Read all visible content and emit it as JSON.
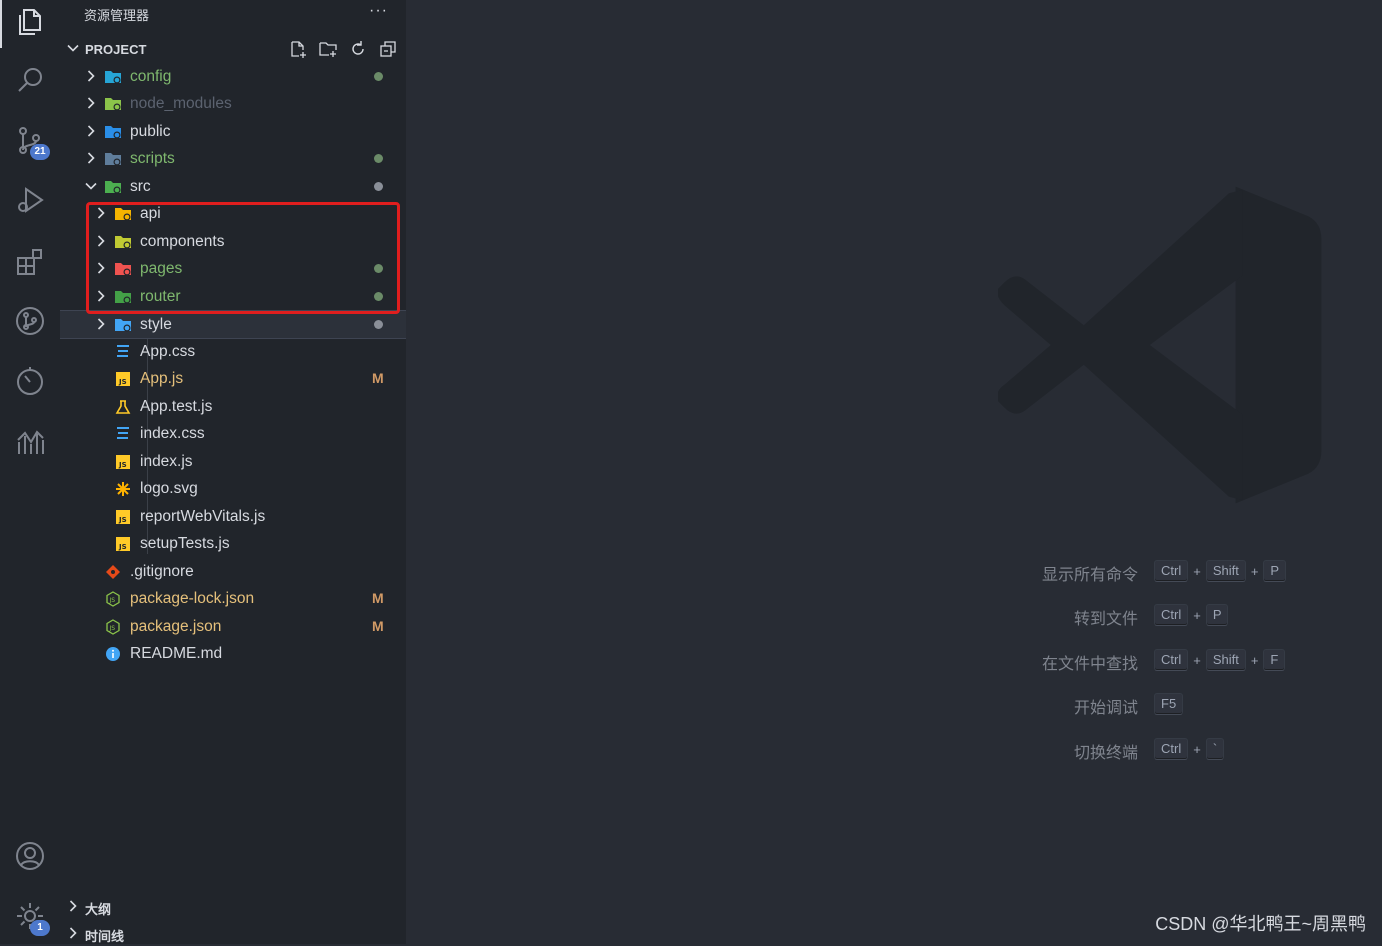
{
  "activity_bar": {
    "items": [
      {
        "name": "explorer-icon"
      },
      {
        "name": "search-icon"
      },
      {
        "name": "source-control-icon",
        "badge": "21"
      },
      {
        "name": "run-debug-icon"
      },
      {
        "name": "extensions-icon"
      },
      {
        "name": "git-graph-icon"
      },
      {
        "name": "timeline-icon"
      },
      {
        "name": "analytics-icon"
      }
    ],
    "bottom": [
      {
        "name": "account-icon"
      },
      {
        "name": "settings-gear-icon",
        "badge": "1"
      }
    ]
  },
  "sidebar": {
    "title": "资源管理器",
    "more_label": "···",
    "section": {
      "title": "PROJECT",
      "actions": [
        "new-file-icon",
        "new-folder-icon",
        "refresh-icon",
        "collapse-all-icon"
      ]
    },
    "tree": [
      {
        "label": "config",
        "type": "folder",
        "icon": "folder-config-icon",
        "icon_color": "#26a5d6",
        "text_color": "#7fb86e",
        "status": "dot",
        "dot_color": "#6b8b68",
        "depth": 0
      },
      {
        "label": "node_modules",
        "type": "folder",
        "icon": "folder-node-icon",
        "icon_color": "#8bc34a",
        "text_color": "#5c6370",
        "status": "",
        "depth": 0
      },
      {
        "label": "public",
        "type": "folder",
        "icon": "folder-public-icon",
        "icon_color": "#2a8ee8",
        "text_color": "#d7dae0",
        "status": "",
        "depth": 0
      },
      {
        "label": "scripts",
        "type": "folder",
        "icon": "folder-scripts-icon",
        "icon_color": "#5f7d9b",
        "text_color": "#7fb86e",
        "status": "dot",
        "dot_color": "#6b8b68",
        "depth": 0
      },
      {
        "label": "src",
        "type": "folder-open",
        "icon": "folder-src-icon",
        "icon_color": "#4caf50",
        "text_color": "#d7dae0",
        "status": "dot",
        "dot_color": "#8a8f98",
        "depth": 0
      },
      {
        "label": "api",
        "type": "folder",
        "icon": "folder-api-icon",
        "icon_color": "#f5b400",
        "text_color": "#d7dae0",
        "status": "",
        "depth": 1
      },
      {
        "label": "components",
        "type": "folder",
        "icon": "folder-components-icon",
        "icon_color": "#c0ca33",
        "text_color": "#d7dae0",
        "status": "",
        "depth": 1
      },
      {
        "label": "pages",
        "type": "folder",
        "icon": "folder-pages-icon",
        "icon_color": "#ef5350",
        "text_color": "#7fb86e",
        "status": "dot",
        "dot_color": "#6b8b68",
        "depth": 1
      },
      {
        "label": "router",
        "type": "folder",
        "icon": "folder-router-icon",
        "icon_color": "#43a047",
        "text_color": "#7fb86e",
        "status": "dot",
        "dot_color": "#6b8b68",
        "depth": 1
      },
      {
        "label": "style",
        "type": "folder",
        "icon": "folder-style-icon",
        "icon_color": "#42a5f5",
        "text_color": "#d7dae0",
        "status": "dot",
        "dot_color": "#8a8f98",
        "depth": 1,
        "selected": true
      },
      {
        "label": "App.css",
        "type": "file",
        "icon": "css-file-icon",
        "icon_color": "#42a5f5",
        "text_color": "#d7dae0",
        "status": "",
        "depth": 1
      },
      {
        "label": "App.js",
        "type": "file",
        "icon": "js-file-icon",
        "icon_color": "#ffca28",
        "text_color": "#e5c07b",
        "status": "M",
        "depth": 1
      },
      {
        "label": "App.test.js",
        "type": "file",
        "icon": "test-file-icon",
        "icon_color": "#ffca28",
        "text_color": "#d7dae0",
        "status": "",
        "depth": 1
      },
      {
        "label": "index.css",
        "type": "file",
        "icon": "css-file-icon",
        "icon_color": "#42a5f5",
        "text_color": "#d7dae0",
        "status": "",
        "depth": 1
      },
      {
        "label": "index.js",
        "type": "file",
        "icon": "js-file-icon",
        "icon_color": "#ffca28",
        "text_color": "#d7dae0",
        "status": "",
        "depth": 1
      },
      {
        "label": "logo.svg",
        "type": "file",
        "icon": "svg-file-icon",
        "icon_color": "#ffb300",
        "text_color": "#d7dae0",
        "status": "",
        "depth": 1
      },
      {
        "label": "reportWebVitals.js",
        "type": "file",
        "icon": "js-file-icon",
        "icon_color": "#ffca28",
        "text_color": "#d7dae0",
        "status": "",
        "depth": 1
      },
      {
        "label": "setupTests.js",
        "type": "file",
        "icon": "js-file-icon",
        "icon_color": "#ffca28",
        "text_color": "#d7dae0",
        "status": "",
        "depth": 1
      },
      {
        "label": ".gitignore",
        "type": "file",
        "icon": "git-file-icon",
        "icon_color": "#e64a19",
        "text_color": "#d7dae0",
        "status": "",
        "depth": 0
      },
      {
        "label": "package-lock.json",
        "type": "file",
        "icon": "node-file-icon",
        "icon_color": "#8bc34a",
        "text_color": "#e5c07b",
        "status": "M",
        "depth": 0
      },
      {
        "label": "package.json",
        "type": "file",
        "icon": "node-file-icon",
        "icon_color": "#8bc34a",
        "text_color": "#e5c07b",
        "status": "M",
        "depth": 0
      },
      {
        "label": "README.md",
        "type": "file",
        "icon": "info-file-icon",
        "icon_color": "#42a5f5",
        "text_color": "#d7dae0",
        "status": "",
        "depth": 0
      }
    ],
    "bottom_sections": [
      {
        "label": "大纲"
      },
      {
        "label": "时间线"
      }
    ]
  },
  "editor": {
    "shortcuts": [
      {
        "label": "显示所有命令",
        "keys": [
          "Ctrl",
          "Shift",
          "P"
        ]
      },
      {
        "label": "转到文件",
        "keys": [
          "Ctrl",
          "P"
        ]
      },
      {
        "label": "在文件中查找",
        "keys": [
          "Ctrl",
          "Shift",
          "F"
        ]
      },
      {
        "label": "开始调试",
        "keys": [
          "F5"
        ]
      },
      {
        "label": "切换终端",
        "keys": [
          "Ctrl",
          "`"
        ]
      }
    ],
    "key_separator": "+",
    "watermark_text": "CSDN @华北鸭王~周黑鸭"
  },
  "colors": {
    "highlight_box": "#e01e1e",
    "badge": "#4d78cc",
    "modified": "#d19a66"
  }
}
